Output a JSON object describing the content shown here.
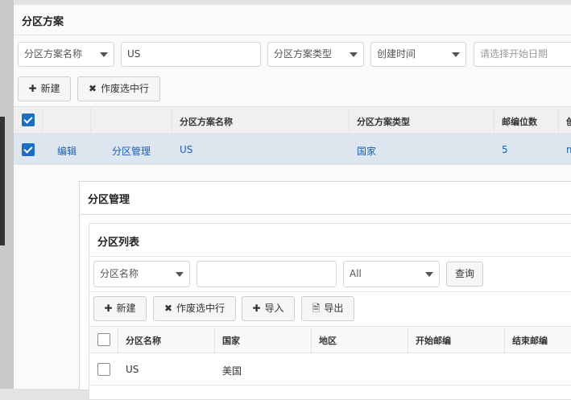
{
  "panel": {
    "title": "分区方案",
    "filters": {
      "name_select": "分区方案名称",
      "name_value": "US",
      "type_select": "分区方案类型",
      "time_select": "创建时间",
      "start_date_placeholder": "请选择开始日期"
    },
    "toolbar": {
      "new_label": "新建",
      "void_label": "作废选中行"
    },
    "table": {
      "headers": [
        "分区方案名称",
        "分区方案类型",
        "邮编位数",
        "创"
      ],
      "row": {
        "edit": "编辑",
        "manage": "分区管理",
        "name": "US",
        "type": "国家",
        "zip_digits": "5",
        "extra": "m"
      }
    }
  },
  "modal": {
    "title": "分区管理",
    "list": {
      "title": "分区列表",
      "filters": {
        "field_select": "分区名称",
        "value": "",
        "scope_select": "All",
        "query_label": "查询"
      },
      "toolbar": {
        "new_label": "新建",
        "void_label": "作废选中行",
        "import_label": "导入",
        "export_label": "导出"
      },
      "headers": [
        "分区名称",
        "国家",
        "地区",
        "开始邮编",
        "结束邮编"
      ],
      "rows": [
        {
          "zone_name": "US",
          "country": "美国"
        }
      ]
    }
  }
}
